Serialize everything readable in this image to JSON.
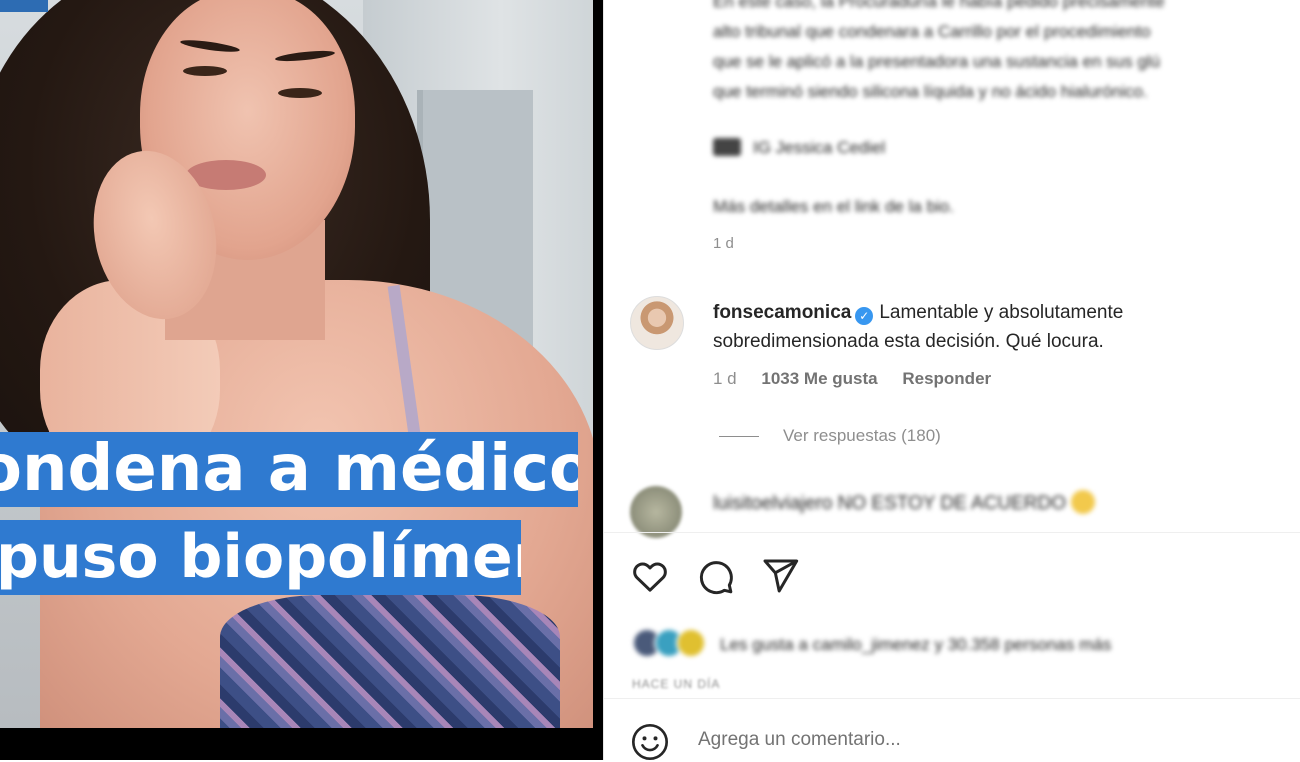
{
  "media": {
    "overlay_line1": "ondena a médico que",
    "overlay_line2": "puso biopolímeros",
    "overlay_color": "#2f7ad0"
  },
  "caption": {
    "line1": "En este caso, la Procuraduría le había pedido precisamente",
    "line2": "alto tribunal que condenara a Carrillo por el procedimiento",
    "line3": "que se le aplicó a la presentadora una sustancia en sus glú",
    "line4": "que terminó siendo silicona líquida y no ácido hialurónico.",
    "credit": "IG Jessica Cediel",
    "more": "Más detalles en el link de la bio.",
    "age": "1 d"
  },
  "comment": {
    "username": "fonsecamonica",
    "verified_icon": "verified-badge-icon",
    "text": "Lamentable y absolutamente sobredimensionada esta decisión. Qué locura.",
    "age": "1 d",
    "likes": "1033 Me gusta",
    "reply": "Responder",
    "view_replies": "Ver respuestas (180)"
  },
  "comment2": {
    "username": "luisitoelviajero",
    "text": "NO ESTOY DE ACUERDO"
  },
  "actions": {
    "like_icon": "heart-icon",
    "comment_icon": "comment-icon",
    "share_icon": "paper-plane-icon"
  },
  "likes_summary": "Les gusta a camilo_jimenez y 30.358 personas más",
  "date_label": "HACE UN DÍA",
  "add_comment": {
    "placeholder": "Agrega un comentario...",
    "emoji_icon": "smiley-icon"
  },
  "colors": {
    "accent": "#3897f0",
    "text": "#262626",
    "muted": "#8e8e8e"
  }
}
